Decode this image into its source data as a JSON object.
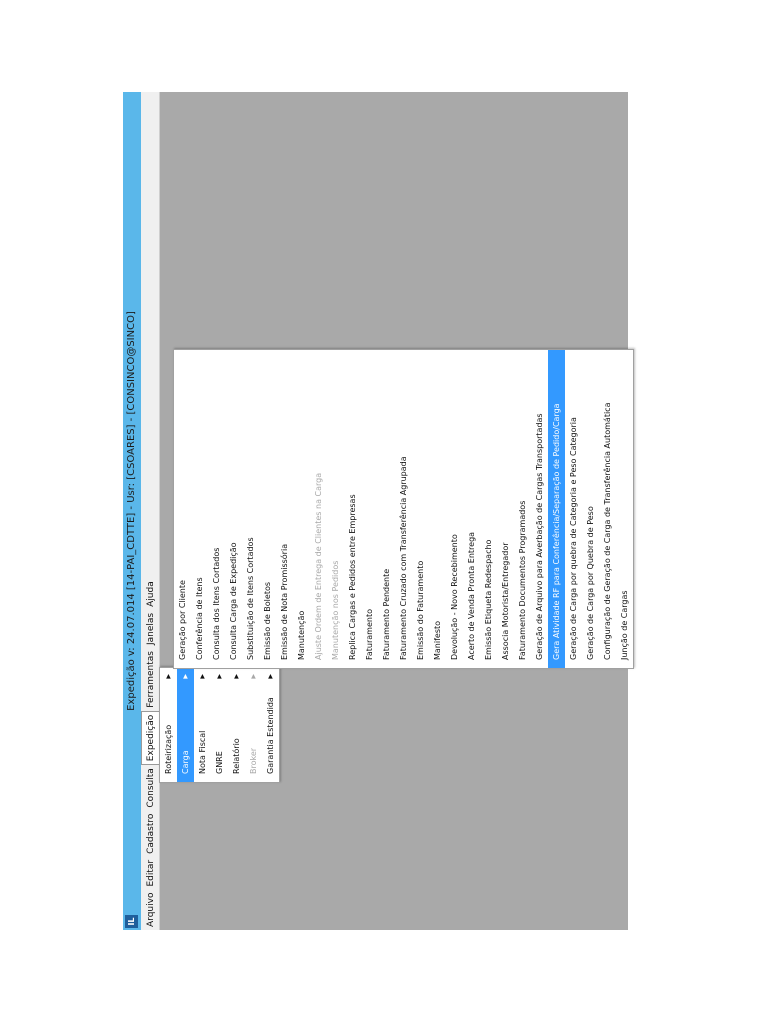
{
  "window": {
    "icon": "app-icon",
    "title": "Expedição   v: 24.07.014   [14-PAI_CDTTE] - Usr: [CSOARES] - [CONSINCO@SINCO]"
  },
  "menubar": {
    "items": [
      "Arquivo",
      "Editar",
      "Cadastro",
      "Consulta",
      "Expedição",
      "Ferramentas",
      "Janelas",
      "Ajuda"
    ]
  },
  "expedicao_menu": {
    "items": [
      {
        "label": "Roteirização",
        "submenu": true
      },
      {
        "label": "Carga",
        "submenu": true,
        "selected": true
      },
      {
        "label": "Nota Fiscal",
        "submenu": true
      },
      {
        "label": "GNRE",
        "submenu": true
      },
      {
        "label": "Relatório",
        "submenu": true
      },
      {
        "label": "Broker",
        "submenu": true,
        "disabled": true
      },
      {
        "label": "Garantia Estendida",
        "submenu": true
      }
    ]
  },
  "carga_menu": {
    "items": [
      {
        "label": "Geração por Cliente"
      },
      {
        "label": "Conferência de Itens"
      },
      {
        "label": "Consulta dos Itens Cortados"
      },
      {
        "label": "Consulta Carga de Expedição"
      },
      {
        "label": "Substituição de Itens Cortados"
      },
      {
        "label": "Emissão de Boletos"
      },
      {
        "label": "Emissão de Nota Promissória"
      },
      {
        "label": "Manutenção"
      },
      {
        "label": "Ajuste Ordem de Entrega de Clientes na Carga",
        "disabled": true
      },
      {
        "label": "Manutenção nos Pedidos",
        "disabled": true
      },
      {
        "label": "Replica Cargas e Pedidos entre Empresas"
      },
      {
        "label": "Faturamento"
      },
      {
        "label": "Faturamento Pendente"
      },
      {
        "label": "Faturamento Cruzado com Transferência Agrupada"
      },
      {
        "label": "Emissão do Faturamento"
      },
      {
        "label": "Manifesto"
      },
      {
        "label": "Devolução - Novo Recebimento"
      },
      {
        "label": "Acerto de Venda Pronta Entrega"
      },
      {
        "label": "Emissão Etiqueta Redespacho"
      },
      {
        "label": "Associa Motorista/Entregador"
      },
      {
        "label": "Faturamento Documentos Programados"
      },
      {
        "label": "Geração de Arquivo para Averbação de Cargas Transportadas"
      },
      {
        "label": "Gera Atividade RF para Conferência/Separação de Pedido/Carga",
        "selected": true
      },
      {
        "label": "Geração de Carga por quebra de Categoria e Peso Categoria"
      },
      {
        "label": "Geração de Carga por Quebra de Peso"
      },
      {
        "label": "Configuração de Geração de Carga de Transferência Automática"
      },
      {
        "label": "Junção de Cargas"
      }
    ]
  }
}
